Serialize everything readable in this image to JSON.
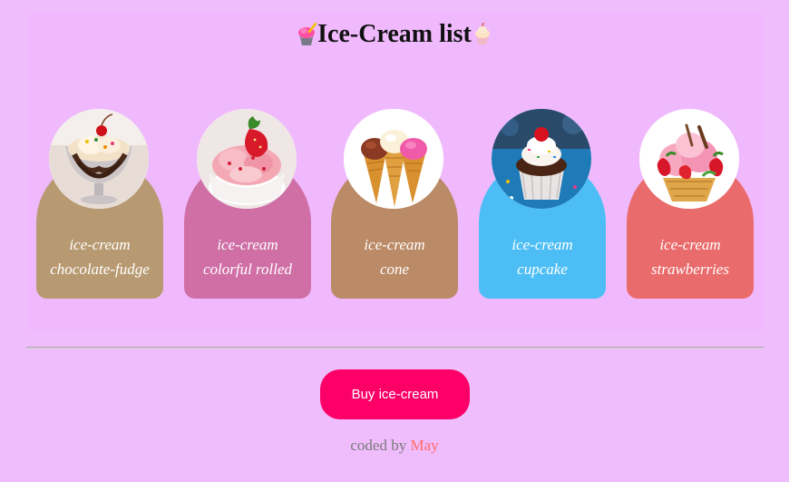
{
  "header": {
    "title": "Ice-Cream list",
    "left_icon": "shaved-ice-icon",
    "right_icon": "ice-cream-cup-icon"
  },
  "cards": [
    {
      "line1": "ice-cream",
      "line2": "chocolate-fudge",
      "color": "#b89a72",
      "image": "sundae-glass"
    },
    {
      "line1": "ice-cream",
      "line2": "colorful rolled",
      "color": "#cf6fa6",
      "image": "strawberry-cup"
    },
    {
      "line1": "ice-cream",
      "line2": "cone",
      "color": "#bb8a66",
      "image": "three-cones"
    },
    {
      "line1": "ice-cream",
      "line2": "cupcake",
      "color": "#4dbef5",
      "image": "cupcake"
    },
    {
      "line1": "ice-cream",
      "line2": "strawberries",
      "color": "#ea6b6b",
      "image": "strawberry-scoops"
    }
  ],
  "actions": {
    "buy_label": "Buy ice-cream",
    "buy_color": "#fc0068"
  },
  "footer": {
    "prefix": "coded by",
    "author": "May",
    "author_color": "#ff6b6b"
  },
  "colors": {
    "background": "#efbcfc"
  }
}
